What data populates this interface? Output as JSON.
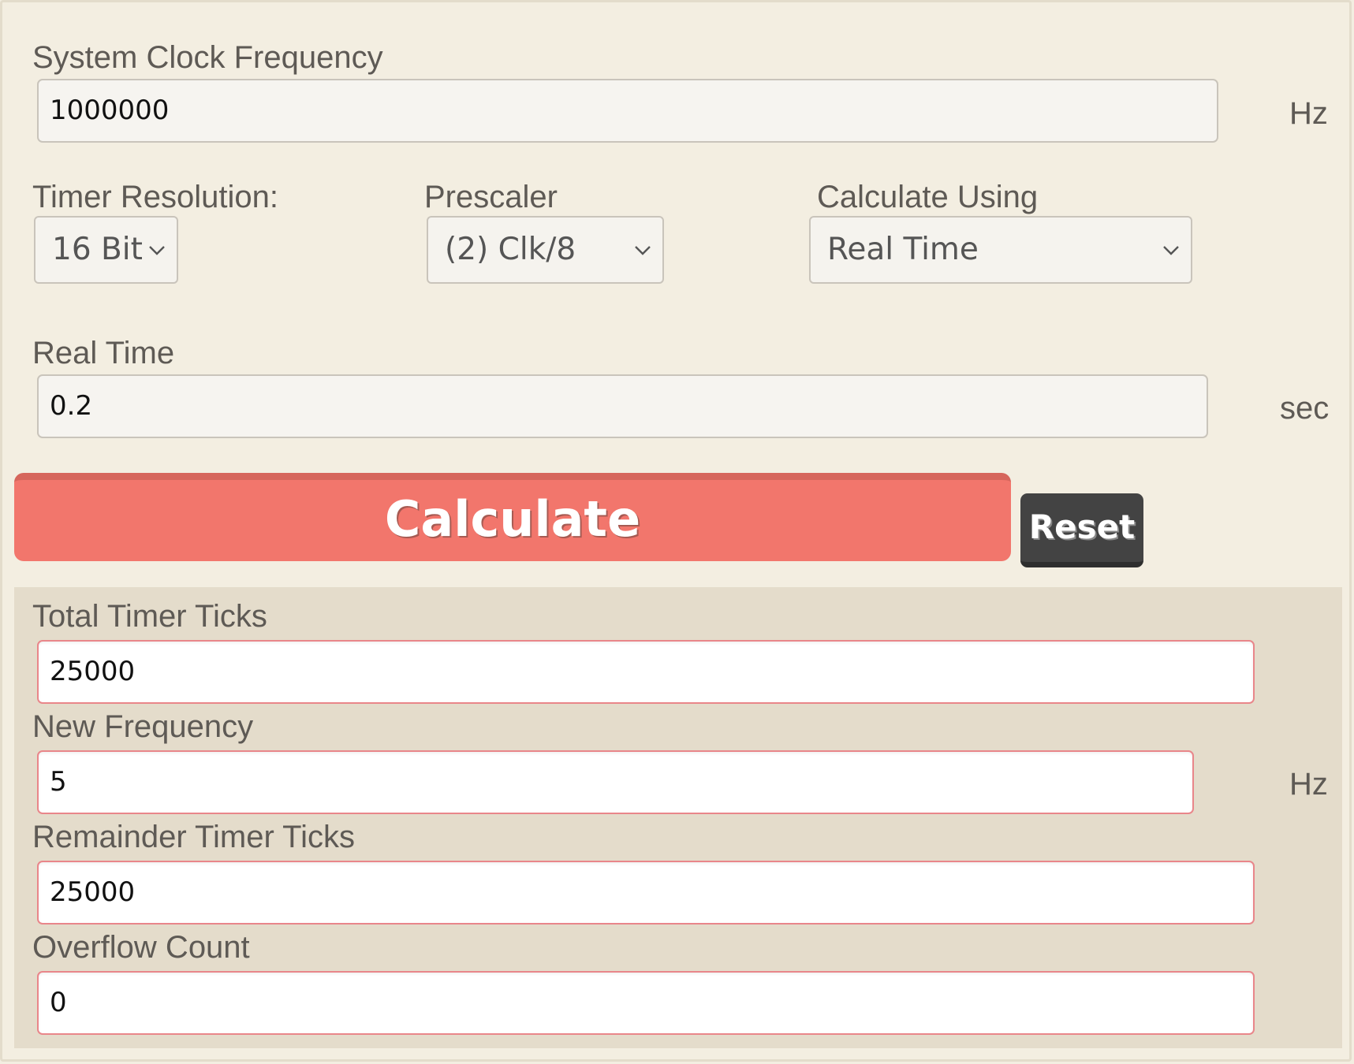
{
  "inputs": {
    "clock": {
      "label": "System Clock Frequency",
      "value": "1000000",
      "unit": "Hz"
    },
    "resolution": {
      "label": "Timer Resolution:",
      "selected": "16 Bit"
    },
    "prescaler": {
      "label": "Prescaler",
      "selected": "(2) Clk/8"
    },
    "calc_using": {
      "label": "Calculate Using",
      "selected": "Real Time"
    },
    "real_time": {
      "label": "Real Time",
      "value": "0.2",
      "unit": "sec"
    }
  },
  "buttons": {
    "calculate": "Calculate",
    "reset": "Reset"
  },
  "results": {
    "total_ticks": {
      "label": "Total Timer Ticks",
      "value": "25000"
    },
    "new_frequency": {
      "label": "New Frequency",
      "value": "5",
      "unit": "Hz"
    },
    "remainder_ticks": {
      "label": "Remainder Timer Ticks",
      "value": "25000"
    },
    "overflow_count": {
      "label": "Overflow Count",
      "value": "0"
    }
  },
  "colors": {
    "background": "#f3eee1",
    "results_background": "#e4dccb",
    "calculate_button": "#f2766c",
    "reset_button": "#434343",
    "result_border": "#e9868a"
  },
  "icons": {
    "dropdown": "chevron-down-icon"
  }
}
